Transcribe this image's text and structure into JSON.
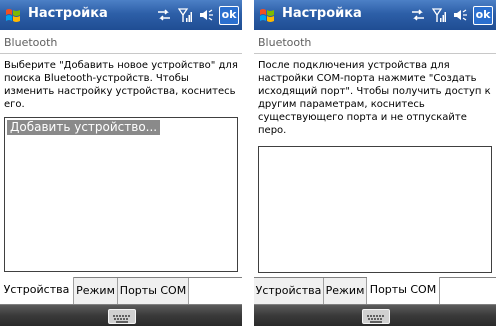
{
  "screens": [
    {
      "title": "Настройка",
      "heading": "Bluetooth",
      "instruction": "Выберите \"Добавить новое устройство\" для поиска Bluetooth-устройств. Чтобы изменить настройку устройства, коснитесь его.",
      "list_items": [
        "Добавить устройство..."
      ],
      "tabs": [
        "Устройства",
        "Режим",
        "Порты COM"
      ],
      "active_tab": 0,
      "ok_label": "ok"
    },
    {
      "title": "Настройка",
      "heading": "Bluetooth",
      "instruction": "После подключения устройства для настройки COM-порта нажмите \"Создать исходящий порт\". Чтобы получить доступ к другим параметрам, коснитесь существующего порта и не отпускайте перо.",
      "list_items": [],
      "tabs": [
        "Устройства",
        "Режим",
        "Порты COM"
      ],
      "active_tab": 2,
      "ok_label": "ok"
    }
  ],
  "icons": {
    "start": "windows-flag-icon",
    "connectivity": "connectivity-arrows-icon",
    "signal": "signal-strength-icon",
    "volume": "speaker-volume-icon",
    "keyboard": "keyboard-icon"
  },
  "colors": {
    "titlebar": "#2d5fa8",
    "selection": "#8a8a8a",
    "menubar": "#3a3a3a"
  }
}
